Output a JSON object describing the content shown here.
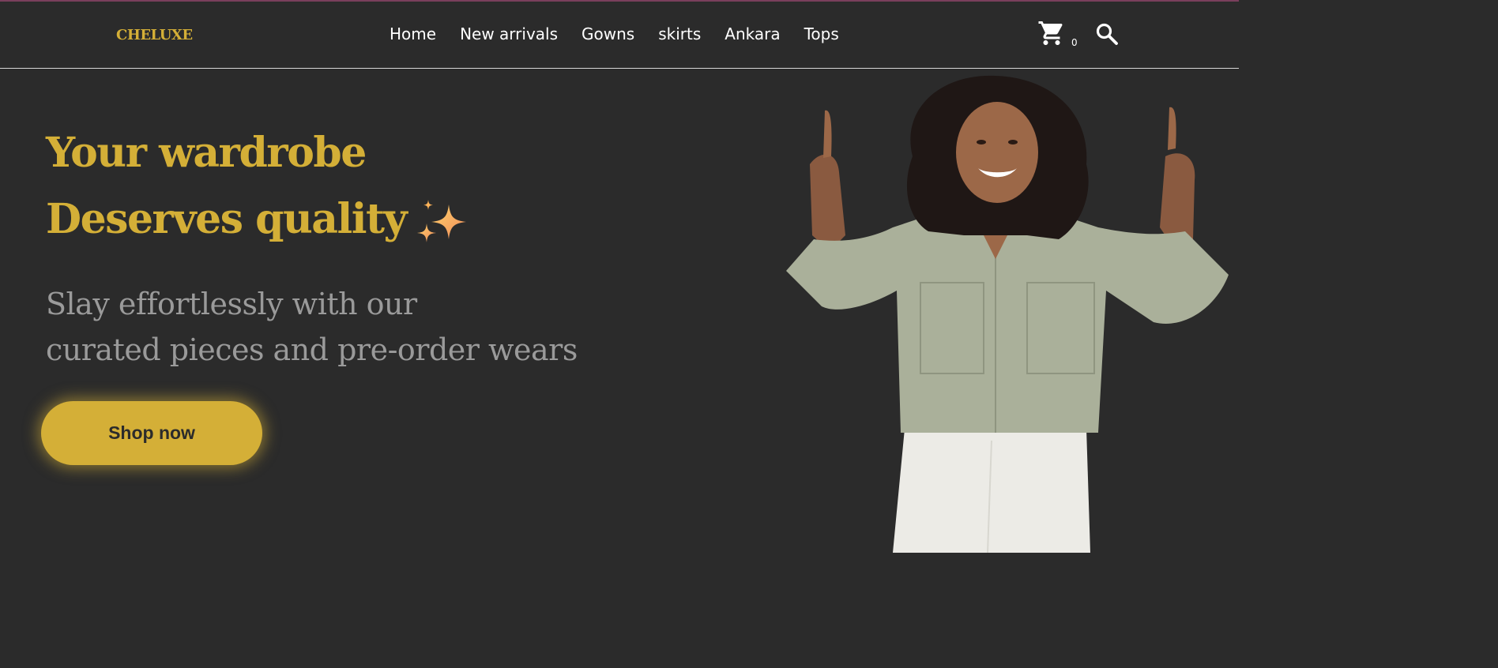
{
  "brand": {
    "name": "CHELUXE",
    "accent_color": "#d4af37",
    "background_color": "#2b2b2b"
  },
  "nav": {
    "links": [
      "Home",
      "New arrivals",
      "Gowns",
      "skirts",
      "Ankara",
      "Tops"
    ]
  },
  "cart": {
    "icon": "shopping-cart-icon",
    "count": "0"
  },
  "search": {
    "icon": "search-icon"
  },
  "hero": {
    "title_line1": "Your wardrobe",
    "title_line2": "Deserves quality",
    "title_emoji": "sparkles-emoji",
    "subtitle_line1": "Slay effortlessly with our",
    "subtitle_line2": "curated pieces and pre-order wears",
    "cta_label": "Shop now",
    "image": "woman-pointing-up-photo"
  }
}
